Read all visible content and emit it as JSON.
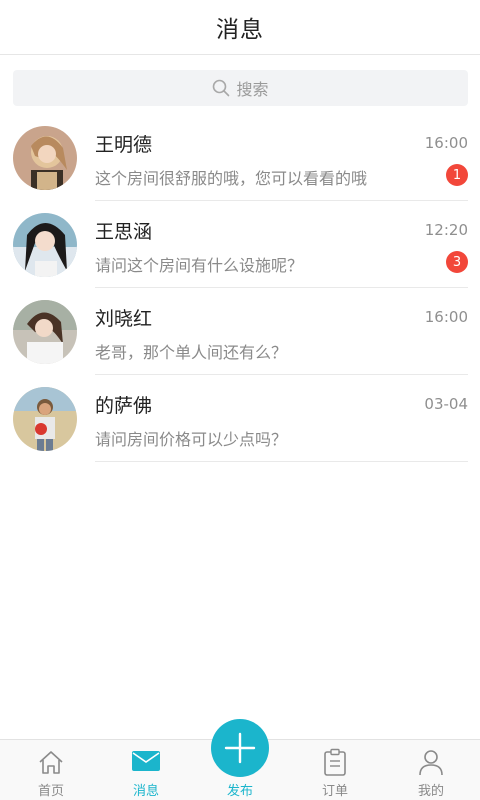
{
  "header": {
    "title": "消息"
  },
  "search": {
    "placeholder": "搜索"
  },
  "conversations": [
    {
      "name": "王明德",
      "time": "16:00",
      "message": "这个房间很舒服的哦，您可以看看的哦",
      "badge": "1"
    },
    {
      "name": "王思涵",
      "time": "12:20",
      "message": "请问这个房间有什么设施呢？",
      "badge": "3"
    },
    {
      "name": "刘晓红",
      "time": "16:00",
      "message": "老哥，那个单人间还有么？",
      "badge": ""
    },
    {
      "name": "的萨佛",
      "time": "03-04",
      "message": "请问房间价格可以少点吗？",
      "badge": ""
    }
  ],
  "tabbar": {
    "home": "首页",
    "messages": "消息",
    "publish": "发布",
    "orders": "订单",
    "mine": "我的"
  },
  "colors": {
    "accent": "#1bb5cc",
    "badge": "#f2473a"
  }
}
